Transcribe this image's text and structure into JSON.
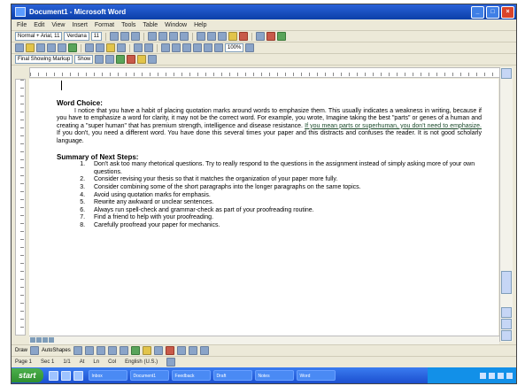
{
  "window": {
    "title": "Document1 - Microsoft Word"
  },
  "menu": [
    "File",
    "Edit",
    "View",
    "Insert",
    "Format",
    "Tools",
    "Table",
    "Window",
    "Help"
  ],
  "toolbar": {
    "style_value": "Normal + Arial, 11",
    "font_value": "Verdana",
    "size_value": "11"
  },
  "document": {
    "word_choice_heading": "Word Choice:",
    "word_choice_text_1": "I notice that you have a habit of placing quotation marks around words to emphasize them. This usually indicates a weakness in writing, because if you have to emphasize a word for clarity, it may not be the correct word. For example, you wrote, Imagine taking the best \"parts\" or genes of a human and creating a \"super human\" that has premium strength, intelligence and disease resistance.",
    "word_choice_link": "If you mean parts or superhuman, you don't need to emphasize.",
    "word_choice_text_2": "If you don't, you need a different word. You have done this several times your paper and this distracts and confuses the reader. It is not good scholarly language.",
    "summary_heading": "Summary of Next Steps:",
    "steps": [
      "Don't ask too many rhetorical questions. Try to really respond to the questions in the assignment instead of simply asking more of your own questions.",
      "Consider revising your thesis so that it matches the organization of your paper more fully.",
      "Consider combining some of the short paragraphs into the longer paragraphs on the same topics.",
      "Avoid using quotation marks for emphasis.",
      "Rewrite any awkward or unclear sentences.",
      "Always run spell-check and grammar-check as part of your proofreading routine.",
      "Find a friend to help with your proofreading.",
      "Carefully proofread your paper for mechanics."
    ]
  },
  "drawbar": {
    "draw_label": "Draw",
    "autoshapes_label": "AutoShapes"
  },
  "statusbar": {
    "page": "Page 1",
    "sec": "Sec 1",
    "pages": "1/1",
    "at": "At",
    "ln": "Ln",
    "col": "Col",
    "language": "English (U.S.)"
  },
  "taskbar": {
    "start_label": "start",
    "tasks": [
      "Inbox",
      "Document1",
      "Feedback",
      "Draft",
      "Notes",
      "Word"
    ]
  },
  "colors": {
    "titlebar": "#0b3fa8",
    "taskbar": "#1c4fcf",
    "start": "#2f8f2f"
  }
}
